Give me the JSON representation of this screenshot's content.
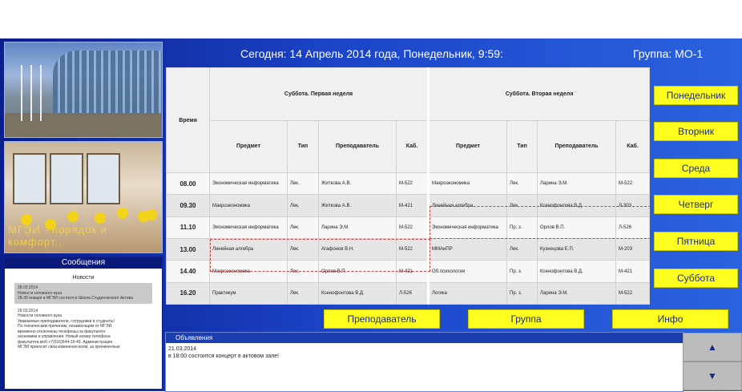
{
  "header": {
    "today": "Сегодня: 14 Апрель 2014 года, Понедельник, 9:59:",
    "group": "Группа: МО-1"
  },
  "photo_caption": "МГЭИ - порядок и комфорт..",
  "messages": {
    "title": "Сообщения",
    "news_title": "Новости",
    "items": [
      "28.03.2014\nНовости головного вуза\n28-30 января в МГЭИ состоится Школа Студенческого Актива",
      "29.03.2014\nНовости головного вуза\nУважаемые преподаватели, сотрудники и студенты!\nПо техническим причинам, независящим от МГЭИ,\nвременно отключены телефоны на факультете\nэкономики и управления. Новый номер телефона\nфакультета моб.+7(916)544-19-49. Администрация\nМГЭИ приносит свои извинения всем, за причиненные"
    ]
  },
  "table": {
    "time_header": "Время",
    "week1_header": "Суббота. Первая неделя",
    "week2_header": "Суббота. Вторая неделя",
    "columns": [
      "Предмет",
      "Тип",
      "Преподаватель",
      "Каб."
    ],
    "rows": [
      {
        "time": "08.00",
        "w1": [
          "Экономическая информатика",
          "Лек.",
          "Житкова А.В.",
          "М-522"
        ],
        "w2": [
          "Макроэкономика",
          "Лек.",
          "Ларина Э.М.",
          "М-522"
        ]
      },
      {
        "time": "09.30",
        "w1": [
          "Макроэкономика",
          "Лек.",
          "Житкова А.В.",
          "М-421"
        ],
        "w2": [
          "Линейная алгебра",
          "Лек.",
          "Ксенофонтова В.Д.",
          "Л-303"
        ]
      },
      {
        "time": "11.10",
        "w1": [
          "Экономическая информатика",
          "Лек.",
          "Ларина Э.М.",
          "М-522"
        ],
        "w2": [
          "Экономическая информатика",
          "Пр. з.",
          "Орлов В.П.",
          "Л-526"
        ]
      },
      {
        "time": "13.00",
        "w1": [
          "Линейная алгебра",
          "Лек.",
          "Агафонов В.Н.",
          "М-522"
        ],
        "w2": [
          "ММАиПР",
          "Лек.",
          "Кузнецова Е.П.",
          "М-203"
        ]
      },
      {
        "time": "14.40",
        "w1": [
          "Макроэкономика",
          "Лек.",
          "Орлов В.П.",
          "М-421"
        ],
        "w2": [
          "Об.психология",
          "Пр. з.",
          "Ксенофонтова В.Д.",
          "М-421"
        ]
      },
      {
        "time": "16.20",
        "w1": [
          "Практикум",
          "Лек.",
          "Ксенофонтова В.Д.",
          "Л-526"
        ],
        "w2": [
          "Логика",
          "Пр. з.",
          "Ларина Э.М.",
          "М-522"
        ]
      }
    ]
  },
  "days": [
    "Понедельник",
    "Вторник",
    "Среда",
    "Четверг",
    "Пятница",
    "Суббота"
  ],
  "bottom_buttons": [
    "Преподаватель",
    "Группа",
    "Инфо"
  ],
  "announcements": {
    "title": "Объявления",
    "date": "21.03.2014",
    "text": "в 18:00 состоится концерт в актовом зале!"
  },
  "scroll": {
    "up": "▲",
    "down": "▼"
  }
}
